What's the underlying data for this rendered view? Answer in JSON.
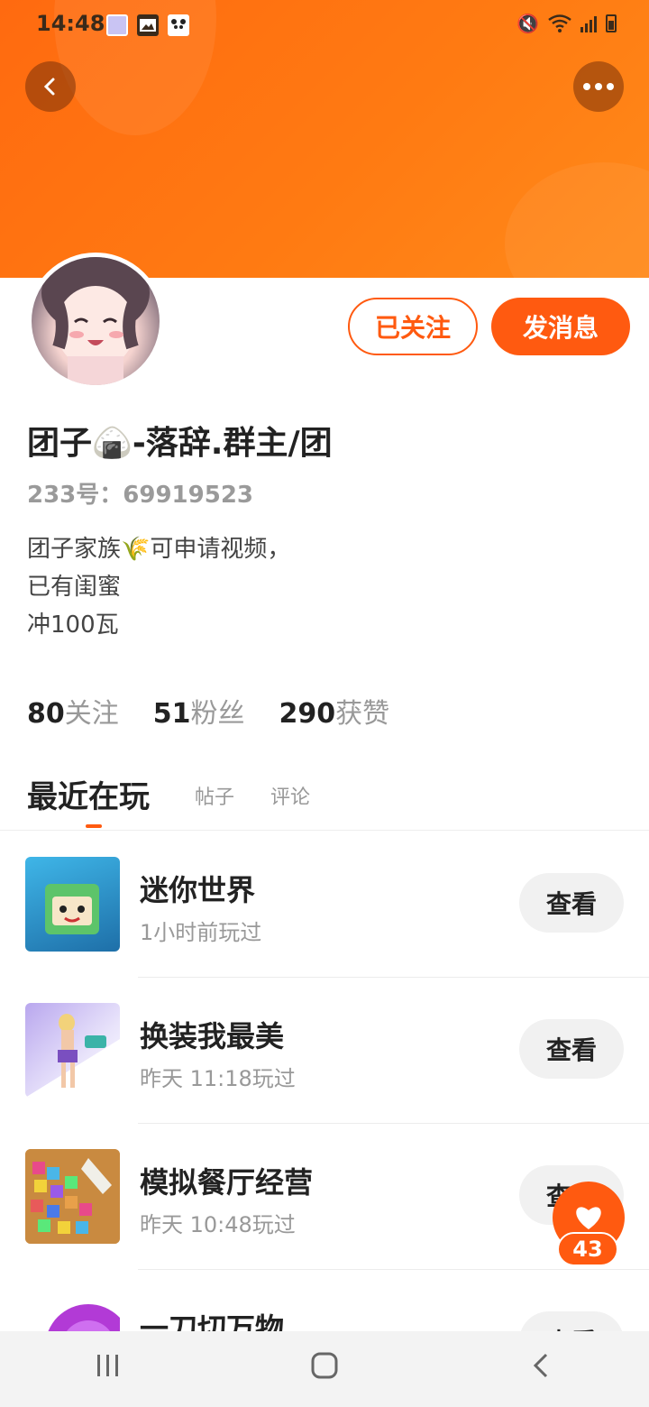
{
  "status_bar": {
    "time": "14:48",
    "icons": [
      "gallery-notification-icon",
      "image-icon",
      "panda-app-icon"
    ],
    "right_icons": [
      "mute-icon",
      "wifi-icon",
      "signal-icon",
      "battery-icon"
    ]
  },
  "header": {
    "back_icon": "chevron-left-icon",
    "more_icon": "more-dots-icon",
    "banner_color": "#ff6a10"
  },
  "profile": {
    "name": "团子🍙-落辞.群主/团",
    "id_text": "233号：69919523",
    "bio_lines": [
      "团子家族🌾可申请视频，",
      "已有闺蜜",
      "冲100瓦"
    ],
    "follow_button": "已关注",
    "message_button": "发消息"
  },
  "stats": [
    {
      "value": "80",
      "label": "关注"
    },
    {
      "value": "51",
      "label": "粉丝"
    },
    {
      "value": "290",
      "label": "获赞"
    }
  ],
  "tabs": [
    {
      "label": "最近在玩",
      "active": true
    },
    {
      "label": "帖子",
      "active": false
    },
    {
      "label": "评论",
      "active": false
    }
  ],
  "games": [
    {
      "title": "迷你世界",
      "played": "1小时前玩过",
      "button": "查看",
      "thumb_color": "#3aa6d8"
    },
    {
      "title": "换装我最美",
      "played": "昨天 11:18玩过",
      "button": "查看",
      "thumb_color": "#c9b8f0"
    },
    {
      "title": "模拟餐厅经营",
      "played": "昨天 10:48玩过",
      "button": "查看",
      "thumb_color": "#e85aa0"
    },
    {
      "title": "一刀切万物",
      "played": "",
      "button": "查看",
      "thumb_color": "#b23ad6"
    }
  ],
  "like_fab": {
    "count": "43"
  },
  "accent_color": "#ff5a10"
}
